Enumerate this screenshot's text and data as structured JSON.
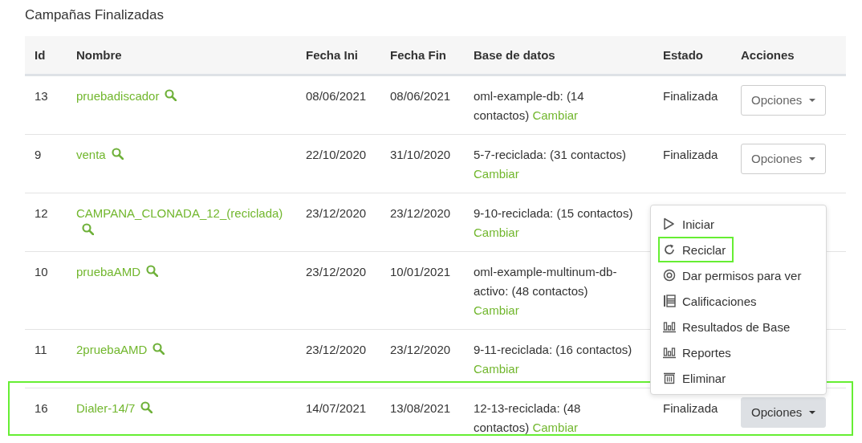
{
  "title": "Campañas Finalizadas",
  "table": {
    "columns": [
      "Id",
      "Nombre",
      "Fecha Ini",
      "Fecha Fin",
      "Base de datos",
      "Estado",
      "Acciones"
    ],
    "rows": [
      {
        "id": "13",
        "name": "pruebadiscador",
        "start": "08/06/2021",
        "end": "08/06/2021",
        "database": "oml-example-db: (14 contactos)",
        "change_link": "Cambiar",
        "status": "Finalizada",
        "action": {
          "label": "Opciones",
          "active": false
        },
        "highlighted": false
      },
      {
        "id": "9",
        "name": "venta",
        "start": "22/10/2020",
        "end": "31/10/2020",
        "database": "5-7-reciclada: (31 contactos)",
        "change_link": "Cambiar",
        "status": "Finalizada",
        "action": {
          "label": "Opciones",
          "active": false
        },
        "highlighted": false
      },
      {
        "id": "12",
        "name": "CAMPANA_CLONADA_12_(reciclada)",
        "start": "23/12/2020",
        "end": "23/12/2020",
        "database": "9-10-reciclada: (15 contactos)",
        "change_link": "Cambiar",
        "highlighted": false
      },
      {
        "id": "10",
        "name": "pruebaAMD",
        "start": "23/12/2020",
        "end": "10/01/2021",
        "database": "oml-example-multinum-db-activo: (48 contactos)",
        "change_link": "Cambiar",
        "highlighted": false
      },
      {
        "id": "11",
        "name": "2pruebaAMD",
        "start": "23/12/2020",
        "end": "23/12/2020",
        "database": "9-11-reciclada: (16 contactos)",
        "change_link": "Cambiar",
        "highlighted": false
      },
      {
        "id": "16",
        "name": "Dialer-14/7",
        "start": "14/07/2021",
        "end": "13/08/2021",
        "database": "12-13-reciclada: (48 contactos)",
        "change_link": "Cambiar",
        "status": "Finalizada",
        "action": {
          "label": "Opciones",
          "active": true
        },
        "highlighted": true
      }
    ]
  },
  "dropdown_menu": {
    "items": [
      {
        "kind": "play",
        "label": "Iniciar",
        "highlighted": false
      },
      {
        "kind": "recycle",
        "label": "Reciclar",
        "highlighted": true
      },
      {
        "kind": "eye",
        "label": "Dar permisos para ver",
        "highlighted": false
      },
      {
        "kind": "list",
        "label": "Calificaciones",
        "highlighted": false
      },
      {
        "kind": "chart",
        "label": "Resultados de Base",
        "highlighted": false
      },
      {
        "kind": "chart",
        "label": "Reportes",
        "highlighted": false
      },
      {
        "kind": "trash",
        "label": "Eliminar",
        "highlighted": false
      }
    ]
  }
}
